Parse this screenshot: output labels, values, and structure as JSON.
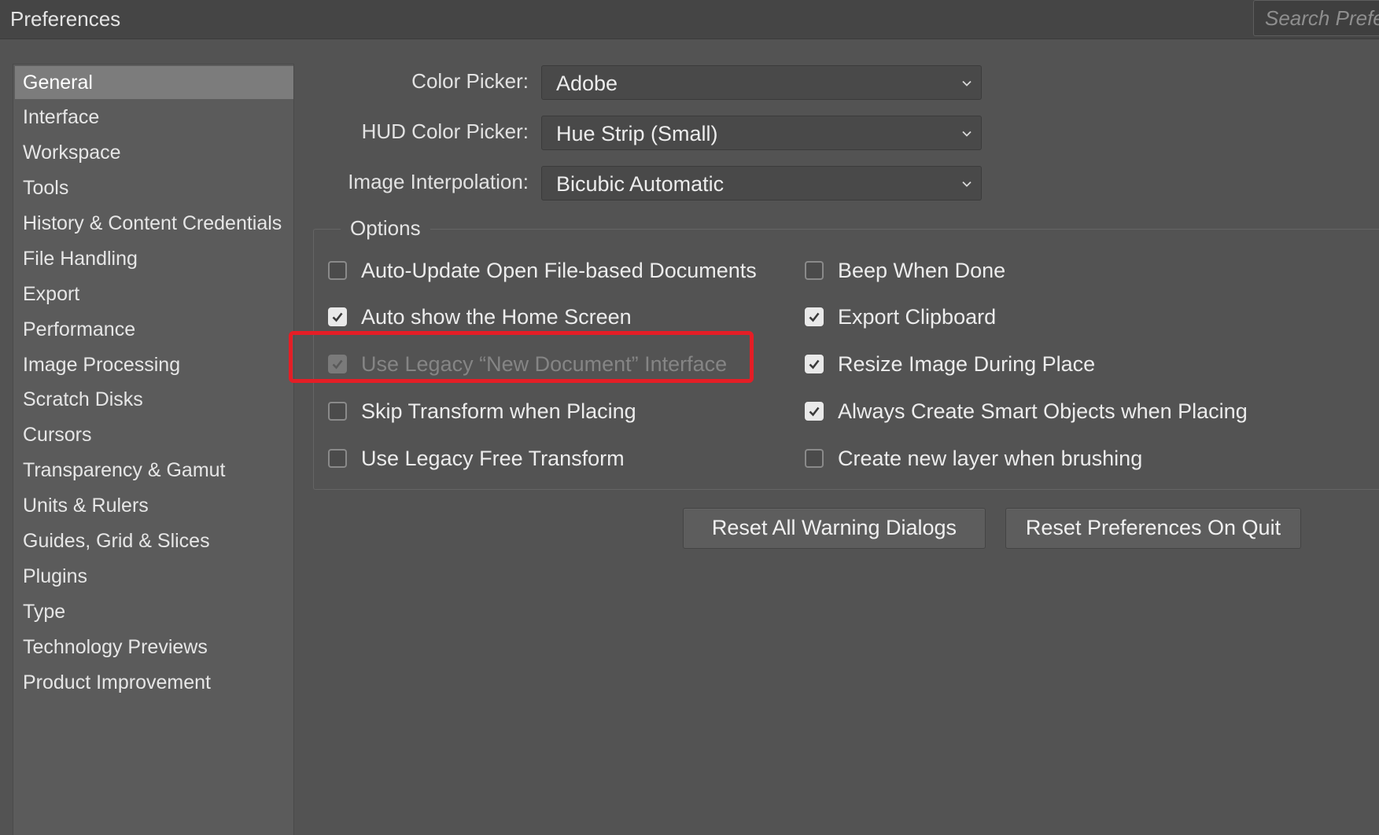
{
  "window": {
    "title": "Preferences",
    "search_placeholder": "Search Preferences"
  },
  "sidebar": {
    "items": [
      {
        "label": "General",
        "selected": true
      },
      {
        "label": "Interface"
      },
      {
        "label": "Workspace"
      },
      {
        "label": "Tools"
      },
      {
        "label": "History & Content Credentials"
      },
      {
        "label": "File Handling"
      },
      {
        "label": "Export"
      },
      {
        "label": "Performance"
      },
      {
        "label": "Image Processing"
      },
      {
        "label": "Scratch Disks"
      },
      {
        "label": "Cursors"
      },
      {
        "label": "Transparency & Gamut"
      },
      {
        "label": "Units & Rulers"
      },
      {
        "label": "Guides, Grid & Slices"
      },
      {
        "label": "Plugins"
      },
      {
        "label": "Type"
      },
      {
        "label": "Technology Previews"
      },
      {
        "label": "Product Improvement"
      }
    ]
  },
  "general": {
    "color_picker": {
      "label": "Color Picker:",
      "value": "Adobe"
    },
    "hud_color_picker": {
      "label": "HUD Color Picker:",
      "value": "Hue Strip (Small)"
    },
    "image_interpolation": {
      "label": "Image Interpolation:",
      "value": "Bicubic Automatic"
    },
    "options": {
      "legend": "Options",
      "left": [
        {
          "label": "Auto-Update Open File-based Documents",
          "checked": false
        },
        {
          "label": "Auto show the Home Screen",
          "checked": true
        },
        {
          "label": "Use Legacy “New Document” Interface",
          "checked": true,
          "disabled": true,
          "highlighted": true
        },
        {
          "label": "Skip Transform when Placing",
          "checked": false
        },
        {
          "label": "Use Legacy Free Transform",
          "checked": false
        }
      ],
      "right": [
        {
          "label": "Beep When Done",
          "checked": false
        },
        {
          "label": "Export Clipboard",
          "checked": true
        },
        {
          "label": "Resize Image During Place",
          "checked": true
        },
        {
          "label": "Always Create Smart Objects when Placing",
          "checked": true
        },
        {
          "label": "Create new layer when brushing",
          "checked": false
        }
      ]
    },
    "buttons": {
      "reset_warnings": "Reset All Warning Dialogs",
      "reset_prefs": "Reset Preferences On Quit"
    }
  },
  "colors": {
    "highlight": "#e41e26",
    "background": "#535353",
    "sidebar_selected": "#7c7c7c"
  }
}
